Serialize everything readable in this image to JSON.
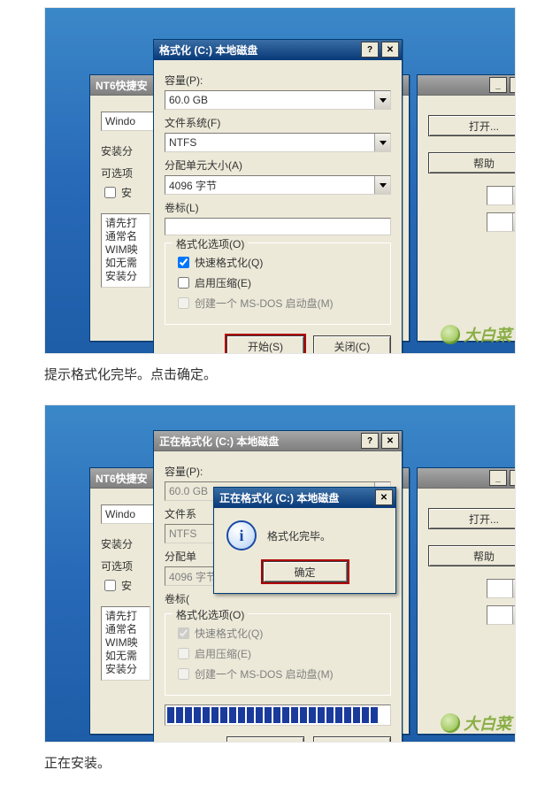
{
  "bg_window": {
    "title": "NT6快捷安",
    "tab_label": "Windo",
    "side_labels": {
      "install": "安装分",
      "optional": "可选项"
    },
    "chk_inst": "安",
    "listbox_lines": "请先打\n通常名\nWIM映\n如无需\n安装分",
    "btn_open": "打开...",
    "btn_help": "帮助"
  },
  "fmt": {
    "title": "格式化 (C:) 本地磁盘",
    "capacity_label": "容量(P):",
    "capacity_value": "60.0 GB",
    "fs_label": "文件系统(F)",
    "fs_value": "NTFS",
    "au_label": "分配单元大小(A)",
    "au_value": "4096 字节",
    "vol_label": "卷标(L)",
    "vol_value": "",
    "opts_legend": "格式化选项(O)",
    "opt_quick": "快速格式化(Q)",
    "opt_compress": "启用压缩(E)",
    "opt_msdos": "创建一个 MS-DOS 启动盘(M)",
    "btn_start": "开始(S)",
    "btn_close": "关闭(C)"
  },
  "fmt2": {
    "title": "正在格式化 (C:) 本地磁盘"
  },
  "msg": {
    "title": "正在格式化 (C:) 本地磁盘",
    "text": "格式化完毕。",
    "ok": "确定"
  },
  "captions": {
    "c1": "提示格式化完毕。点击确定。",
    "c2": "正在安装。"
  },
  "watermark": "大白菜",
  "glyphs": {
    "help": "?",
    "close": "✕",
    "min": "_",
    "max": "□"
  }
}
